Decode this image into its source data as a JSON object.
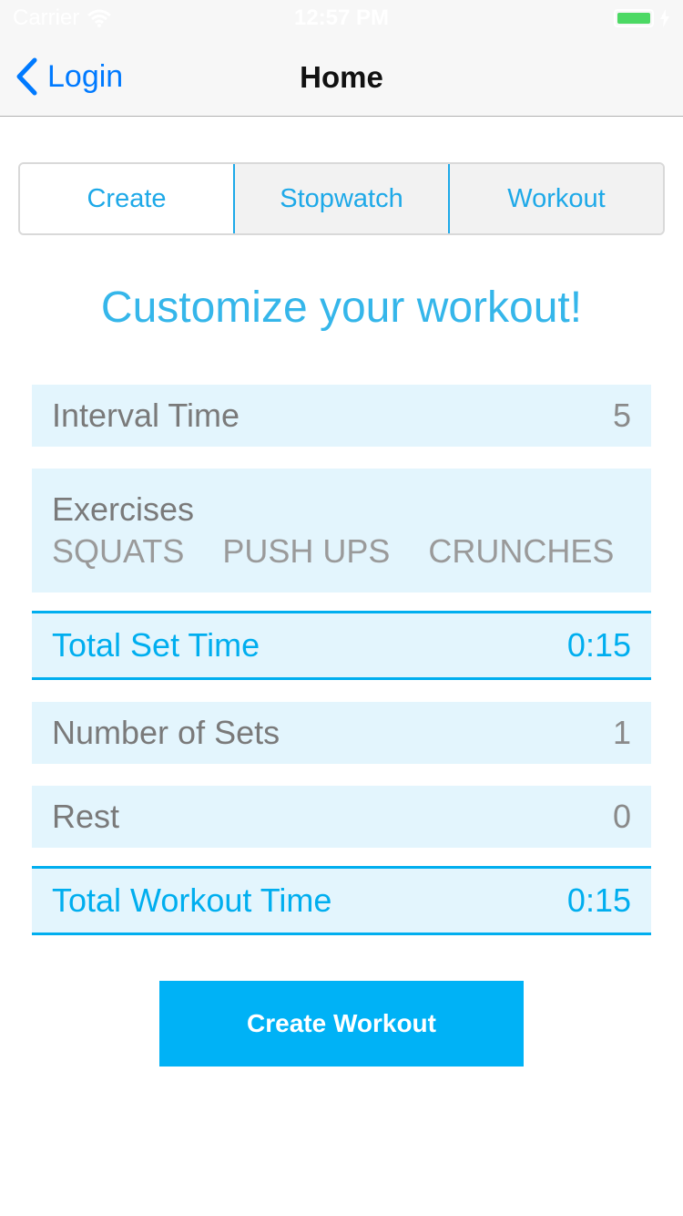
{
  "status_bar": {
    "carrier": "Carrier",
    "time": "12:57 PM",
    "battery_color": "#4cd964"
  },
  "nav": {
    "back_label": "Login",
    "title": "Home",
    "tint_color": "#007aff"
  },
  "tabs": [
    {
      "label": "Create",
      "selected": true
    },
    {
      "label": "Stopwatch",
      "selected": false
    },
    {
      "label": "Workout",
      "selected": false
    }
  ],
  "heading": "Customize your workout!",
  "interval": {
    "label": "Interval Time",
    "value": "5"
  },
  "exercises": {
    "label": "Exercises",
    "items": [
      "SQUATS",
      "PUSH UPS",
      "CRUNCHES"
    ]
  },
  "total_set": {
    "label": "Total Set Time",
    "value": "0:15"
  },
  "sets": {
    "label": "Number of Sets",
    "value": "1"
  },
  "rest": {
    "label": "Rest",
    "value": "0"
  },
  "total_workout": {
    "label": "Total Workout Time",
    "value": "0:15"
  },
  "create_button": {
    "label": "Create Workout"
  },
  "colors": {
    "accent": "#00aeef",
    "row_background": "#e3f5fd",
    "button": "#00b2f6"
  }
}
